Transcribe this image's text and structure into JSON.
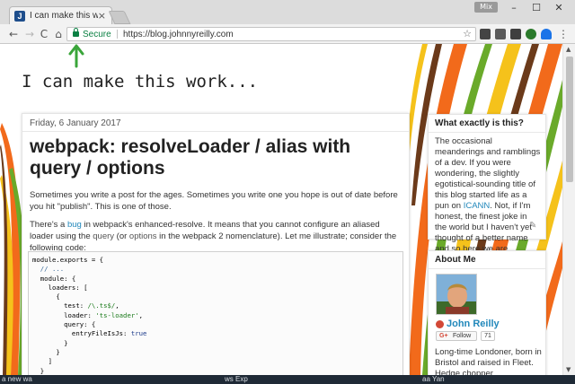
{
  "browser": {
    "tab_title": "I can make this work...",
    "tab_favicon": "J",
    "tab_close": "×",
    "profile_label": "Mix",
    "window_minimize": "–",
    "window_maximize": "☐",
    "window_close": "✕",
    "nav_back": "←",
    "nav_forward": "→",
    "nav_reload": "C",
    "nav_home": "⌂",
    "secure_label": "Secure",
    "url": "https://blog.johnnyreilly.com",
    "bookmark_star": "☆",
    "menu": "⋮"
  },
  "page": {
    "blog_title": "I can make this work...",
    "annotation_arrow_color": "#3aa53a",
    "post": {
      "date": "Friday, 6 January 2017",
      "title": "webpack: resolveLoader / alias with query / options",
      "intro": "Sometimes you write a post for the ages. Sometimes you write one you hope is out of date before you hit \"publish\". This is one of those.",
      "p2_before_link": "There's a ",
      "p2_link": "bug",
      "p2_after_link": " in webpack's enhanced-resolve. It means that you cannot configure an aliased loader using the ",
      "p2_code1": "query",
      "p2_mid": " (or ",
      "p2_code2": "options",
      "p2_end": " in the webpack 2 nomenclature). Let me illustrate; consider the following code:",
      "code": {
        "l1": "module.exports = {",
        "l2": "  // ...",
        "l3": "  module: {",
        "l4": "    loaders: [",
        "l5": "      {",
        "l6a": "        test: ",
        "l6b": "/\\.ts$/",
        "l6c": ",",
        "l7a": "        loader: ",
        "l7b": "'ts-loader'",
        "l7c": ",",
        "l8": "        query: {",
        "l9a": "          entryFileIsJs: ",
        "l9b": "true",
        "l10": "        }",
        "l11": "      }",
        "l12": "    ]",
        "l13": "  }"
      }
    },
    "sidebar": {
      "about_heading": "What exactly is this?",
      "about_before_link": "The occasional meanderings and ramblings of a dev. If you were wondering, the slightly egotistical-sounding title of this blog started life as a pun on ",
      "about_link": "ICANN",
      "about_after_link": ". Not, if I'm honest, the finest joke in the world but I haven't yet thought of a better name and so here we are...",
      "me_heading": "About Me",
      "author_name": "John Reilly",
      "follow_g": "G+",
      "follow_label": "Follow",
      "follow_count": "71",
      "me_text": "Long-time Londoner, born in Bristol and raised in Fleet.  Hedge chopper extraordinaire, father, food"
    },
    "colors": {
      "link": "#2288bb",
      "secure": "#0b8043",
      "stripe_orange": "#f26a1b",
      "stripe_green": "#6aaa2a",
      "stripe_yellow": "#f5c21b",
      "stripe_brown": "#6b3a1a"
    }
  },
  "taskbar": {
    "left_label": "a new wa",
    "mid_label": "ws Exp",
    "right_label": "aa Yan"
  }
}
